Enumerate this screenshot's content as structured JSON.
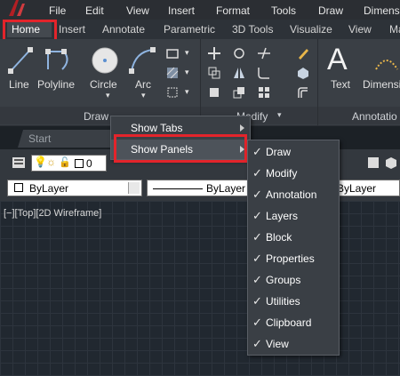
{
  "menubar": {
    "items": [
      "File",
      "Edit",
      "View",
      "Insert",
      "Format",
      "Tools",
      "Draw",
      "Dimens"
    ]
  },
  "ribbon_tabs": {
    "items": [
      "Home",
      "Insert",
      "Annotate",
      "Parametric",
      "3D Tools",
      "Visualize",
      "View",
      "Ma"
    ],
    "active": "Home"
  },
  "draw_panel": {
    "tools": [
      "Line",
      "Polyline",
      "Circle",
      "Arc"
    ],
    "title": "Draw"
  },
  "modify_panel": {
    "title": "Modify"
  },
  "annotation_panel": {
    "tools": [
      "Text",
      "Dimensi"
    ],
    "title": "Annotatio"
  },
  "file_tabs": {
    "start": "Start"
  },
  "layer_toolbar": {
    "layer_value": "0"
  },
  "properties_toolbar": {
    "color": "ByLayer",
    "linetype": "ByLayer",
    "lineweight": "ByLayer"
  },
  "viewport": {
    "label": "[−][Top][2D Wireframe]"
  },
  "context_menu": {
    "items": [
      {
        "label": "Show Tabs",
        "has_submenu": true
      },
      {
        "label": "Show Panels",
        "has_submenu": true
      }
    ]
  },
  "panels_submenu": {
    "items": [
      {
        "label": "Draw",
        "checked": true
      },
      {
        "label": "Modify",
        "checked": true
      },
      {
        "label": "Annotation",
        "checked": true
      },
      {
        "label": "Layers",
        "checked": true
      },
      {
        "label": "Block",
        "checked": true
      },
      {
        "label": "Properties",
        "checked": true
      },
      {
        "label": "Groups",
        "checked": true
      },
      {
        "label": "Utilities",
        "checked": true
      },
      {
        "label": "Clipboard",
        "checked": true
      },
      {
        "label": "View",
        "checked": true
      }
    ],
    "check_glyph": "✓"
  },
  "colors": {
    "highlight_box": "#e3242b",
    "menu_bg": "#3a3f45",
    "canvas_bg": "#212830"
  }
}
